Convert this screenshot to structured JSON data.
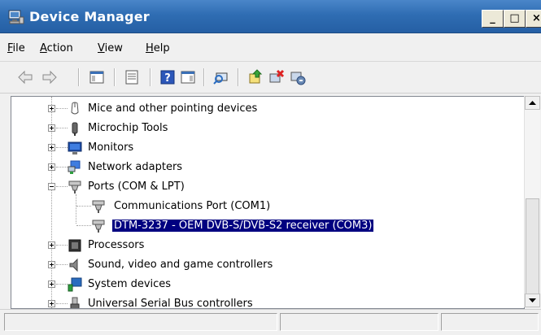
{
  "window": {
    "title": "Device Manager",
    "controls": [
      "_",
      "□",
      "×"
    ]
  },
  "menu": [
    {
      "label": "File",
      "accel": "F",
      "rest": "ile"
    },
    {
      "label": "Action",
      "accel": "A",
      "rest": "ction"
    },
    {
      "label": "View",
      "accel": "V",
      "rest": "iew"
    },
    {
      "label": "Help",
      "accel": "H",
      "rest": "elp"
    }
  ],
  "toolbar_icons": [
    "back-arrow-icon",
    "forward-arrow-icon",
    "show-hide-console-tree-icon",
    "properties-icon",
    "help-icon",
    "action-pane-icon",
    "scan-hardware-icon",
    "update-driver-icon",
    "uninstall-icon",
    "disable-device-icon"
  ],
  "tree": {
    "items": [
      {
        "label": "Mice and other pointing devices",
        "icon": "mouse-icon"
      },
      {
        "label": "Microchip Tools",
        "icon": "microchip-tools-icon"
      },
      {
        "label": "Monitors",
        "icon": "monitor-icon"
      },
      {
        "label": "Network adapters",
        "icon": "network-adapter-icon"
      },
      {
        "label": "Ports (COM & LPT)",
        "icon": "port-icon",
        "expanded": true
      },
      {
        "label": "Communications Port (COM1)",
        "icon": "port-icon",
        "child": true
      },
      {
        "label": "DTM-3237 - OEM DVB-S/DVB-S2 receiver (COM3)",
        "icon": "port-icon",
        "child": true,
        "selected": true
      },
      {
        "label": "Processors",
        "icon": "processor-icon"
      },
      {
        "label": "Sound, video and game controllers",
        "icon": "speaker-icon"
      },
      {
        "label": "System devices",
        "icon": "system-devices-icon"
      },
      {
        "label": "Universal Serial Bus controllers",
        "icon": "usb-icon"
      }
    ]
  },
  "colors": {
    "title_bar": "#2f6db3",
    "selection": "#000080"
  }
}
